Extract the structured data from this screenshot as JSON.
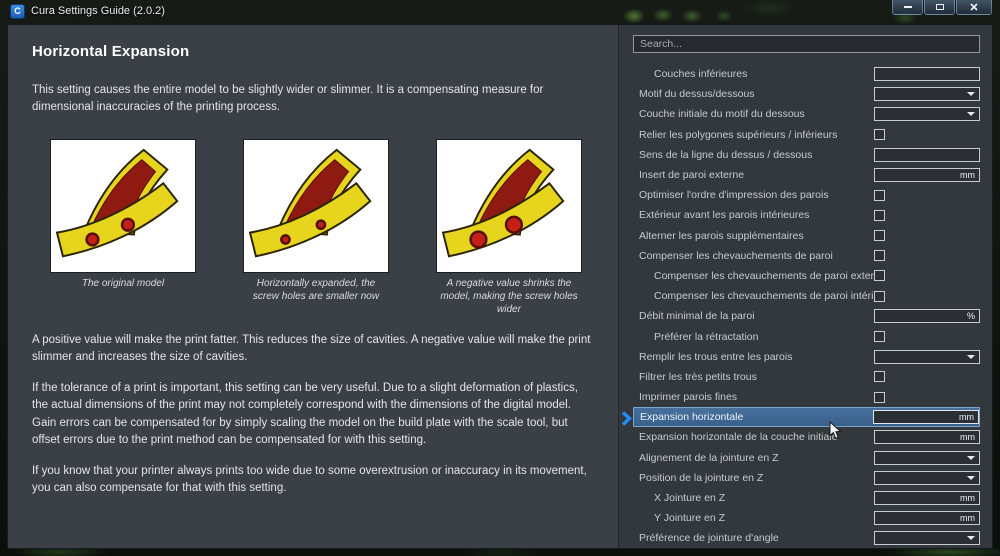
{
  "window": {
    "title": "Cura Settings Guide (2.0.2)",
    "logo_letter": "C",
    "controls": [
      "minimize",
      "maximize",
      "close"
    ]
  },
  "article": {
    "title": "Horizontal Expansion",
    "intro": "This setting causes the entire model to be slightly wider or slimmer. It is a compensating measure for dimensional inaccuracies of the printing process.",
    "figures": [
      {
        "caption": "The original model"
      },
      {
        "caption": "Horizontally expanded, the screw holes are smaller now"
      },
      {
        "caption": "A negative value shrinks the model, making the screw holes wider"
      }
    ],
    "paragraphs": [
      "A positive value will make the print fatter. This reduces the size of cavities. A negative value will make the print slimmer and increases the size of cavities.",
      "If the tolerance of a print is important, this setting can be very useful. Due to a slight deformation of plastics, the actual dimensions of the print may not completely correspond with the dimensions of the digital model. Gain errors can be compensated for by simply scaling the model on the build plate with the scale tool, but offset errors due to the print method can be compensated for with this setting.",
      "If you know that your printer always prints too wide due to some overextrusion or inaccuracy in its movement, you can also compensate for that with this setting."
    ]
  },
  "sidebar": {
    "search_placeholder": "Search...",
    "settings": [
      {
        "label": "Couches inférieures",
        "indent": 1,
        "control": "input"
      },
      {
        "label": "Motif du dessus/dessous",
        "indent": 0,
        "control": "select"
      },
      {
        "label": "Couche initiale du motif du dessous",
        "indent": 0,
        "control": "select"
      },
      {
        "label": "Relier les polygones supérieurs / inférieurs",
        "indent": 0,
        "control": "checkbox"
      },
      {
        "label": "Sens de la ligne du dessus / dessous",
        "indent": 0,
        "control": "input"
      },
      {
        "label": "Insert de paroi externe",
        "indent": 0,
        "control": "input",
        "unit": "mm"
      },
      {
        "label": "Optimiser l'ordre d'impression des parois",
        "indent": 0,
        "control": "checkbox"
      },
      {
        "label": "Extérieur avant les parois intérieures",
        "indent": 0,
        "control": "checkbox"
      },
      {
        "label": "Alterner les parois supplémentaires",
        "indent": 0,
        "control": "checkbox"
      },
      {
        "label": "Compenser les chevauchements de paroi",
        "indent": 0,
        "control": "checkbox"
      },
      {
        "label": "Compenser les chevauchements de paroi externe",
        "indent": 1,
        "control": "checkbox"
      },
      {
        "label": "Compenser les chevauchements de paroi intérieure",
        "indent": 1,
        "control": "checkbox"
      },
      {
        "label": "Débit minimal de la paroi",
        "indent": 0,
        "control": "input",
        "unit": "%"
      },
      {
        "label": "Préférer la rétractation",
        "indent": 1,
        "control": "checkbox"
      },
      {
        "label": "Remplir les trous entre les parois",
        "indent": 0,
        "control": "select"
      },
      {
        "label": "Filtrer les très petits trous",
        "indent": 0,
        "control": "checkbox"
      },
      {
        "label": "Imprimer parois fines",
        "indent": 0,
        "control": "checkbox"
      },
      {
        "label": "Expansion horizontale",
        "indent": 0,
        "control": "input",
        "unit": "mm",
        "highlighted": true
      },
      {
        "label": "Expansion horizontale de la couche initiale",
        "indent": 0,
        "control": "input",
        "unit": "mm"
      },
      {
        "label": "Alignement de la jointure en Z",
        "indent": 0,
        "control": "select"
      },
      {
        "label": "Position de la jointure en Z",
        "indent": 0,
        "control": "select"
      },
      {
        "label": "X Jointure en Z",
        "indent": 1,
        "control": "input",
        "unit": "mm"
      },
      {
        "label": "Y Jointure en Z",
        "indent": 1,
        "control": "input",
        "unit": "mm"
      },
      {
        "label": "Préférence de jointure d'angle",
        "indent": 0,
        "control": "select"
      }
    ]
  },
  "colors": {
    "highlight_row": "#3f6c9c",
    "highlight_border": "#7aa7d4",
    "accent_arrow": "#1f8fff",
    "panel_left": "#3b4046",
    "panel_right": "#33383d"
  }
}
